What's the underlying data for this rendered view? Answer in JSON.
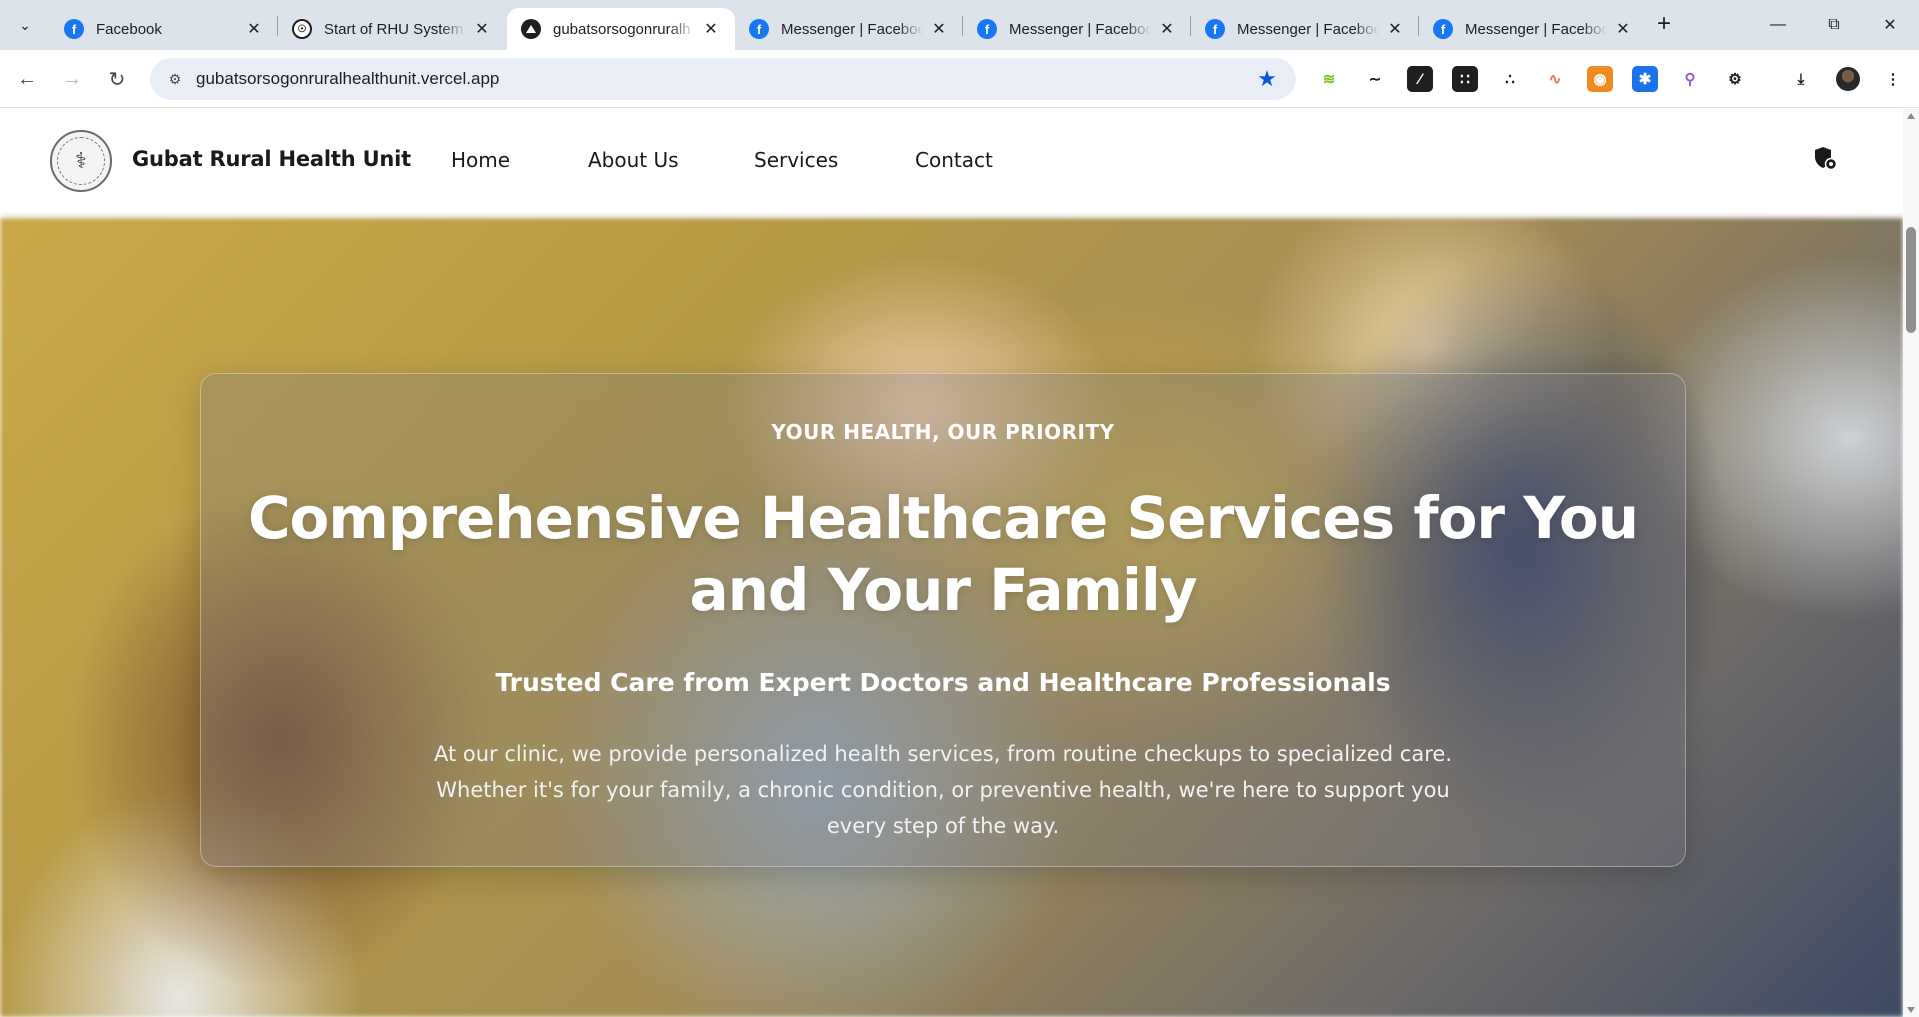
{
  "browser": {
    "tabs": [
      {
        "title": "Facebook",
        "favicon": "facebook-icon",
        "active": false
      },
      {
        "title": "Start of RHU System",
        "favicon": "globe-icon",
        "active": false
      },
      {
        "title": "gubatsorsogonruralh",
        "favicon": "vercel-icon",
        "active": true
      },
      {
        "title": "Messenger | Facebook",
        "favicon": "facebook-icon",
        "active": false
      },
      {
        "title": "Messenger | Facebook",
        "favicon": "facebook-icon",
        "active": false
      },
      {
        "title": "Messenger | Facebook",
        "favicon": "facebook-icon",
        "active": false
      },
      {
        "title": "Messenger | Facebook",
        "favicon": "facebook-icon",
        "active": false
      }
    ],
    "url": "gubatsorsogonruralhealthunit.vercel.app",
    "accent_color": "#0b57d0"
  },
  "site": {
    "brand": "Gubat Rural Health Unit",
    "nav": [
      "Home",
      "About Us",
      "Services",
      "Contact"
    ]
  },
  "hero": {
    "eyebrow": "YOUR HEALTH, OUR PRIORITY",
    "title": "Comprehensive Healthcare Services for You and Your Family",
    "subtitle": "Trusted Care from Expert Doctors and Healthcare Professionals",
    "body": "At our clinic, we provide personalized health services, from routine checkups to specialized care. Whether it's for your family, a chronic condition, or preventive health, we're here to support you every step of the way."
  }
}
